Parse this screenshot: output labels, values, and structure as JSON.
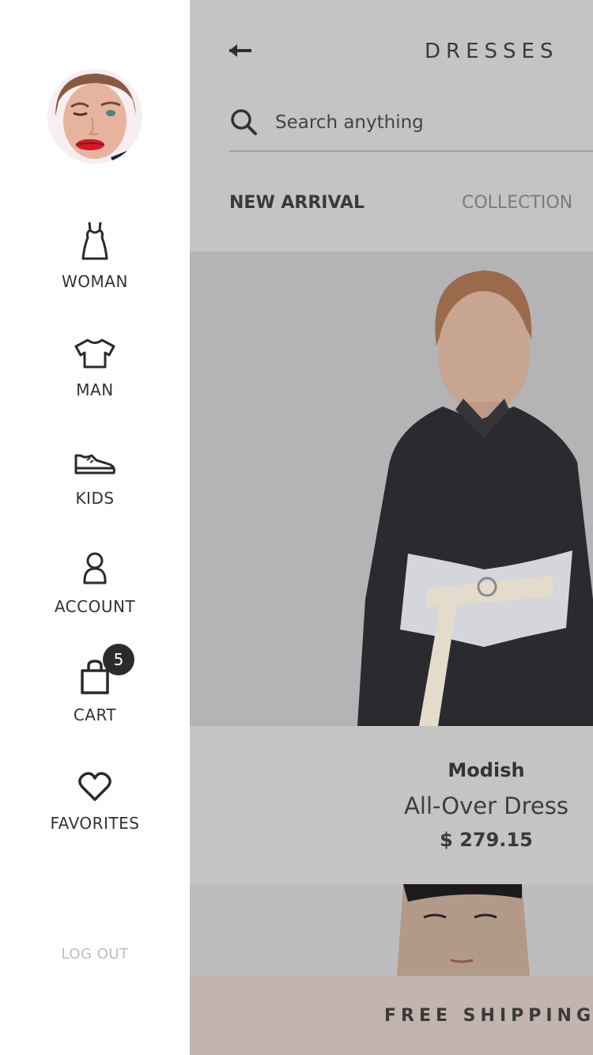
{
  "sidebar": {
    "items": [
      {
        "label": "WOMAN",
        "icon": "dress-icon"
      },
      {
        "label": "MAN",
        "icon": "tshirt-icon"
      },
      {
        "label": "KIDS",
        "icon": "sneaker-icon"
      },
      {
        "label": "ACCOUNT",
        "icon": "user-icon"
      },
      {
        "label": "CART",
        "icon": "shopping-bag-icon",
        "badge": "5"
      },
      {
        "label": "FAVORITES",
        "icon": "heart-icon"
      }
    ],
    "logout_label": "LOG OUT"
  },
  "header": {
    "title": "DRESSES"
  },
  "search": {
    "placeholder": "Search anything"
  },
  "tabs": [
    {
      "label": "NEW ARRIVAL",
      "active": true
    },
    {
      "label": "COLLECTION",
      "active": false
    }
  ],
  "product": {
    "brand": "Modish",
    "name": "All-Over Dress",
    "price": "$ 279.15"
  },
  "banner": {
    "text": "FREE SHIPPING"
  },
  "colors": {
    "overlay": "#c4c4c4",
    "banner": "#c2b5ae",
    "text_dark": "#3a3a3a",
    "badge": "#2b2b2b"
  }
}
